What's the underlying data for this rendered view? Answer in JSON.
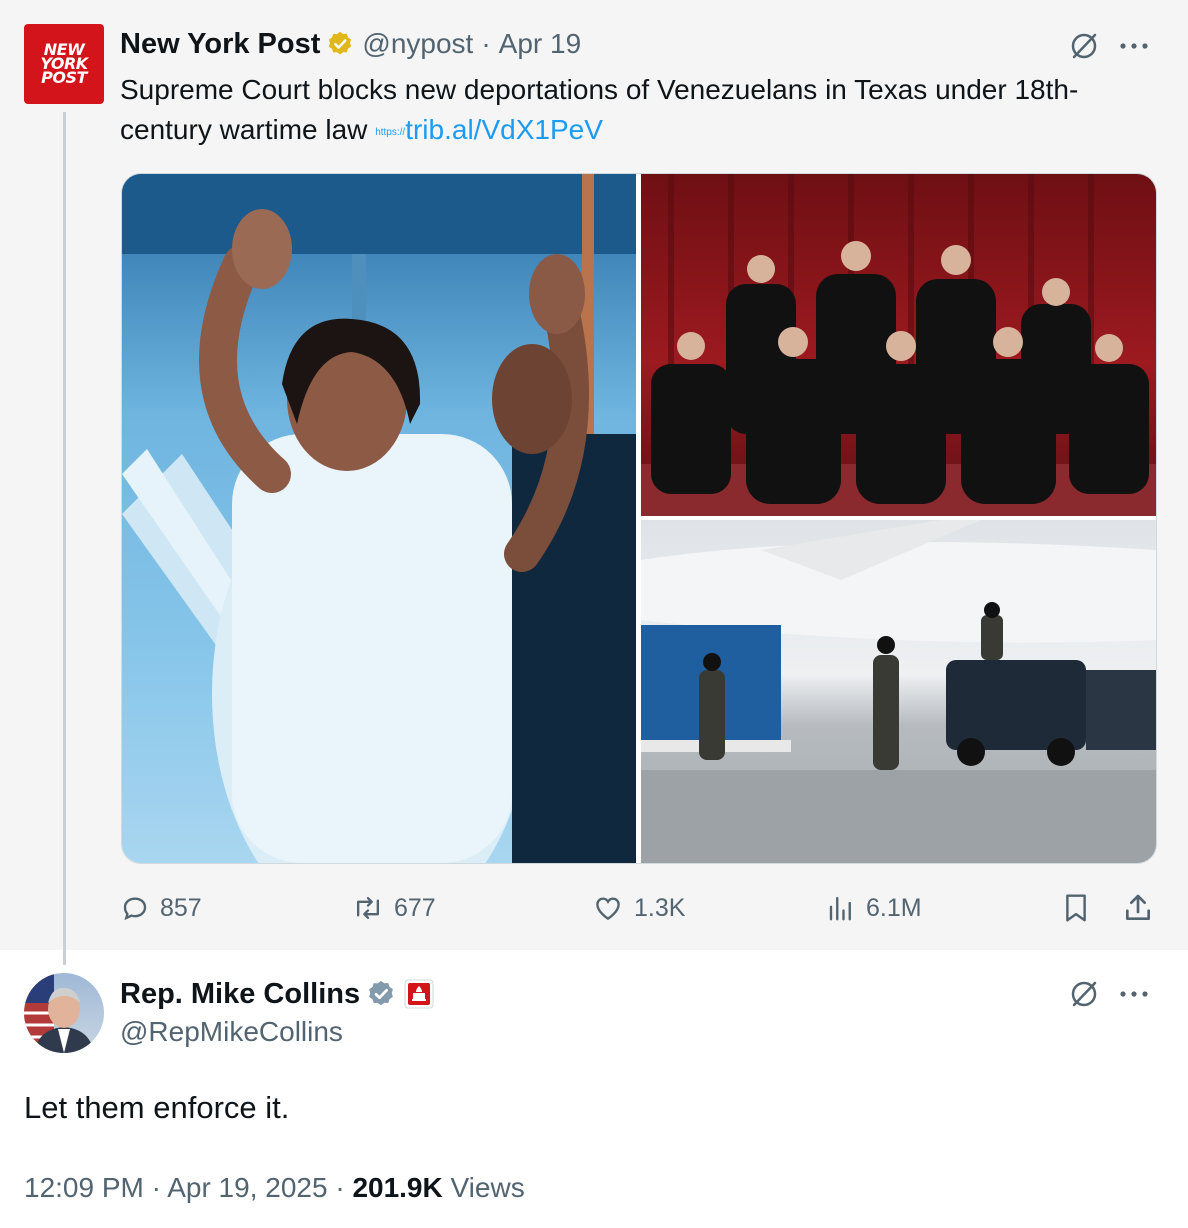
{
  "quoted_tweet": {
    "logo_lines": [
      "NEW",
      "YORK",
      "POST"
    ],
    "name": "New York Post",
    "handle": "@nypost",
    "separator": "·",
    "date": "Apr 19",
    "text": "Supreme Court blocks new deportations of Venezuelans in Texas under 18th-century wartime law",
    "link_prefix": "https://",
    "link_text": "trib.al/VdX1PeV",
    "verified_badge_color": "#e2b719",
    "media": [
      "waving-man-photo",
      "supreme-court-justices-photo",
      "airport-security-photo"
    ],
    "stats": {
      "replies": "857",
      "reposts": "677",
      "likes": "1.3K",
      "views": "6.1M"
    }
  },
  "reply_tweet": {
    "name": "Rep. Mike Collins",
    "handle": "@RepMikeCollins",
    "text": "Let them enforce it.",
    "time": "12:09 PM",
    "separator": "·",
    "date": "Apr 19, 2025",
    "views_count": "201.9K",
    "views_label": "Views",
    "verified_badge_color": "#829aab",
    "affiliate_badge_color": "#d3141b"
  },
  "icons": {
    "more": "more-icon",
    "grok": "grok-icon",
    "reply": "reply-icon",
    "repost": "repost-icon",
    "like": "like-icon",
    "views": "views-icon",
    "bookmark": "bookmark-icon",
    "share": "share-icon"
  },
  "colors": {
    "link": "#1d9bf0",
    "muted": "#536471",
    "text": "#0f1419"
  }
}
